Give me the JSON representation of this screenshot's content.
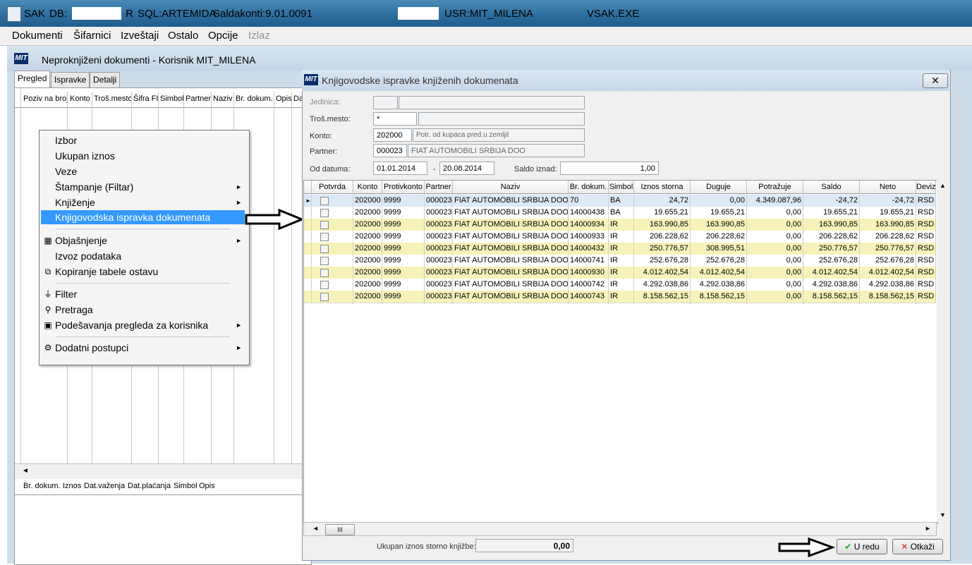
{
  "window": {
    "app": "SAK",
    "db_label": "DB:",
    "db_suffix": "R",
    "sql": "SQL:ARTEMIDA",
    "version": "Saldakonti:9.01.0091",
    "user": "USR:MIT_MILENA",
    "exe": "VSAK.EXE"
  },
  "menu": [
    "Dokumenti",
    "Šifarnici",
    "Izveštaji",
    "Ostalo",
    "Opcije",
    "Izlaz"
  ],
  "child": {
    "logo": "MIT",
    "title": "Neproknjiženi dokumenti - Korisnik MIT_MILENA",
    "tabs": [
      "Pregled",
      "Ispravke",
      "Detalji"
    ],
    "top_columns": [
      "Poziv na broj",
      "Konto",
      "Troš.mesto",
      "Šifra FI",
      "Simbol",
      "Partner",
      "Naziv",
      "Br. dokum.",
      "Opis",
      "Da"
    ],
    "bottom_columns": [
      "Br. dokum.",
      "Iznos",
      "Dat.važenja",
      "Dat.plaćanja",
      "Simbol",
      "Opis"
    ],
    "hscroll_left": "◄"
  },
  "context_menu": {
    "items": [
      "Izbor",
      "Ukupan iznos",
      "Veze",
      "Štampanje (Filtar)",
      "Knjiženje",
      "Knjigovodska ispravka dokumenata",
      "Objašnjenje",
      "Izvoz podataka",
      "Kopiranje tabele ostavu",
      "Filter",
      "Pretraga",
      "Podešavanja pregleda za korisnika",
      "Dodatni postupci"
    ],
    "submenu_arrow": "►"
  },
  "dialog": {
    "logo": "MIT",
    "title": "Knjigovodske ispravke knjiženih dokumenata",
    "close": "✕",
    "fields": {
      "jedinica_label": "Jedinica:",
      "trosmesto_label": "Troš.mesto:",
      "trosmesto_value": "*",
      "konto_label": "Konto:",
      "konto_value": "202000",
      "konto_name": "Potr. od kupaca pred.u zemljil",
      "partner_label": "Partner:",
      "partner_value": "000023",
      "partner_name": "FIAT AUTOMOBILI SRBIJA DOO",
      "od_datuma_label": "Od datuma:",
      "date_from": "01.01.2014",
      "date_sep": "-",
      "date_to": "20.08.2014",
      "saldo_label": "Saldo iznad:",
      "saldo_value": "1,00"
    },
    "columns": [
      "Potvrda",
      "Konto",
      "Protivkonto",
      "Partner",
      "Naziv",
      "Br. dokum.",
      "Simbol",
      "Iznos storna",
      "Duguje",
      "Potražuje",
      "Saldo",
      "Neto",
      "Deviz"
    ],
    "rows": [
      {
        "konto": "202000",
        "protivkonto": "9999",
        "partner": "000023",
        "naziv": "FIAT AUTOMOBILI SRBIJA DOO",
        "brdok": "70",
        "simbol": "BA",
        "storno": "24,72",
        "duguje": "0,00",
        "potrazuje": "4.349.087,96",
        "saldo": "-24,72",
        "neto": "-24,72",
        "deviz": "RSD"
      },
      {
        "konto": "202000",
        "protivkonto": "9999",
        "partner": "000023",
        "naziv": "FIAT AUTOMOBILI SRBIJA DOO",
        "brdok": "14000438",
        "simbol": "BA",
        "storno": "19.655,21",
        "duguje": "19.655,21",
        "potrazuje": "0,00",
        "saldo": "19.655,21",
        "neto": "19.655,21",
        "deviz": "RSD"
      },
      {
        "konto": "202000",
        "protivkonto": "9999",
        "partner": "000023",
        "naziv": "FIAT AUTOMOBILI SRBIJA DOO",
        "brdok": "14000934",
        "simbol": "IR",
        "storno": "163.990,85",
        "duguje": "163.990,85",
        "potrazuje": "0,00",
        "saldo": "163.990,85",
        "neto": "163.990,85",
        "deviz": "RSD"
      },
      {
        "konto": "202000",
        "protivkonto": "9999",
        "partner": "000023",
        "naziv": "FIAT AUTOMOBILI SRBIJA DOO",
        "brdok": "14000933",
        "simbol": "IR",
        "storno": "206.228,62",
        "duguje": "206.228,62",
        "potrazuje": "0,00",
        "saldo": "206.228,62",
        "neto": "206.228,62",
        "deviz": "RSD"
      },
      {
        "konto": "202000",
        "protivkonto": "9999",
        "partner": "000023",
        "naziv": "FIAT AUTOMOBILI SRBIJA DOO",
        "brdok": "14000432",
        "simbol": "IR",
        "storno": "250.776,57",
        "duguje": "308.995,51",
        "potrazuje": "0,00",
        "saldo": "250.776,57",
        "neto": "250.776,57",
        "deviz": "RSD"
      },
      {
        "konto": "202000",
        "protivkonto": "9999",
        "partner": "000023",
        "naziv": "FIAT AUTOMOBILI SRBIJA DOO",
        "brdok": "14000741",
        "simbol": "IR",
        "storno": "252.676,28",
        "duguje": "252.676,28",
        "potrazuje": "0,00",
        "saldo": "252.676,28",
        "neto": "252.676,28",
        "deviz": "RSD"
      },
      {
        "konto": "202000",
        "protivkonto": "9999",
        "partner": "000023",
        "naziv": "FIAT AUTOMOBILI SRBIJA DOO",
        "brdok": "14000930",
        "simbol": "IR",
        "storno": "4.012.402,54",
        "duguje": "4.012.402,54",
        "potrazuje": "0,00",
        "saldo": "4.012.402,54",
        "neto": "4.012.402,54",
        "deviz": "RSD"
      },
      {
        "konto": "202000",
        "protivkonto": "9999",
        "partner": "000023",
        "naziv": "FIAT AUTOMOBILI SRBIJA DOO",
        "brdok": "14000742",
        "simbol": "IR",
        "storno": "4.292.038,86",
        "duguje": "4.292.038,86",
        "potrazuje": "0,00",
        "saldo": "4.292.038,86",
        "neto": "4.292.038,86",
        "deviz": "RSD"
      },
      {
        "konto": "202000",
        "protivkonto": "9999",
        "partner": "000023",
        "naziv": "FIAT AUTOMOBILI SRBIJA DOO",
        "brdok": "14000743",
        "simbol": "IR",
        "storno": "8.158.562,15",
        "duguje": "8.158.562,15",
        "potrazuje": "0,00",
        "saldo": "8.158.562,15",
        "neto": "8.158.562,15",
        "deviz": "RSD"
      }
    ],
    "total_label": "Ukupan iznos storno knjižbe:",
    "total_value": "0,00",
    "ok_label": "U redu",
    "cancel_label": "Otkaži",
    "ok_icon": "✔",
    "cancel_icon": "✕",
    "scroll_thumb": "III",
    "scroll_up": "▲",
    "scroll_down": "▼",
    "scroll_left": "◄",
    "scroll_right": "►",
    "row_pointer": "►"
  },
  "colors": {
    "highlight": "#3399ff",
    "row_yellow": "#f7f2b8",
    "row_white": "#ffffff",
    "row_selected": "#dce9f7"
  }
}
